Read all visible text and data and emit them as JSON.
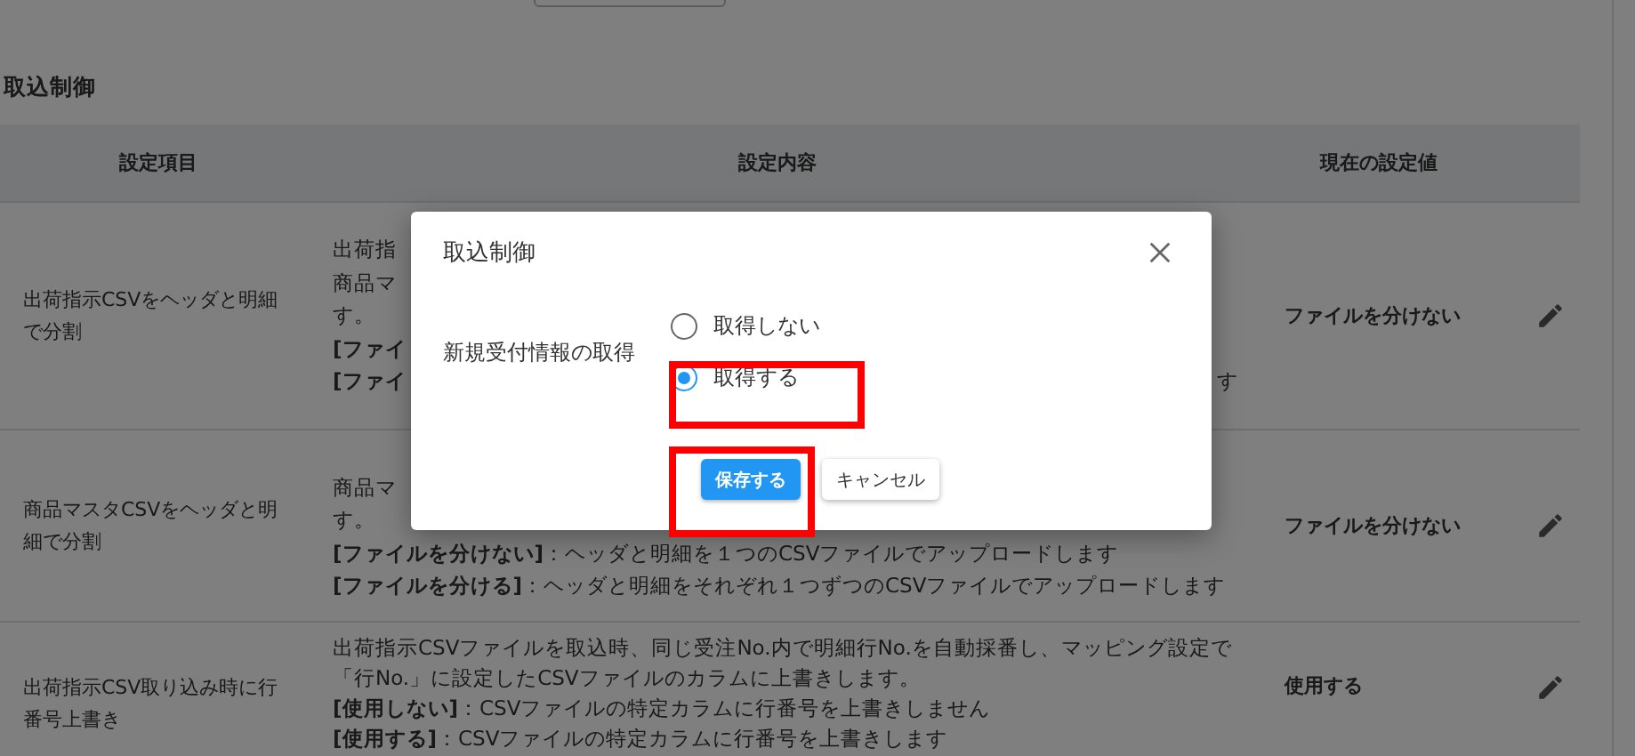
{
  "section_title": "取込制御",
  "table": {
    "columns": [
      "設定項目",
      "設定内容",
      "現在の設定値"
    ],
    "rows": [
      {
        "item": "出荷指示CSVをヘッダと明細で分割",
        "lines": [
          {
            "text": "出荷指",
            "bold": false
          },
          {
            "text": "商品マ",
            "bold": false
          },
          {
            "text": "す。",
            "bold": false
          },
          {
            "text": "[ファイ",
            "bold": true
          },
          {
            "text": "[ファイ",
            "bold": true,
            "tail": "す"
          }
        ],
        "value": "ファイルを分けない"
      },
      {
        "item": "商品マスタCSVをヘッダと明細で分割",
        "lines": [
          {
            "text": "商品マ",
            "bold": false
          },
          {
            "text": "す。",
            "bold": false
          },
          {
            "text": "**[ファイルを分けない]**：ヘッダと明細を１つのCSVファイルでアップロードします",
            "bold": false
          },
          {
            "text": "**[ファイルを分ける]**：ヘッダと明細をそれぞれ１つずつのCSVファイルでアップロードします",
            "bold": false
          }
        ],
        "value": "ファイルを分けない"
      },
      {
        "item": "出荷指示CSV取り込み時に行番号上書き",
        "lines": [
          {
            "text": "出荷指示CSVファイルを取込時、同じ受注No.内で明細行No.を自動採番し、マッピング設定で",
            "bold": false
          },
          {
            "text": "「行No.」に設定したCSVファイルのカラムに上書きします。",
            "bold": false
          },
          {
            "text": "**[使用しない]**：CSVファイルの特定カラムに行番号を上書きしません",
            "bold": false
          },
          {
            "text": "**[使用する]**：CSVファイルの特定カラムに行番号を上書きします",
            "bold": false
          }
        ],
        "value": "使用する"
      }
    ]
  },
  "dialog": {
    "title": "取込制御",
    "field_label": "新規受付情報の取得",
    "options": [
      {
        "label": "取得しない",
        "selected": false
      },
      {
        "label": "取得する",
        "selected": true
      }
    ],
    "buttons": [
      {
        "label": "保存する",
        "kind": "primary"
      },
      {
        "label": "キャンセル",
        "kind": "secondary"
      }
    ]
  }
}
